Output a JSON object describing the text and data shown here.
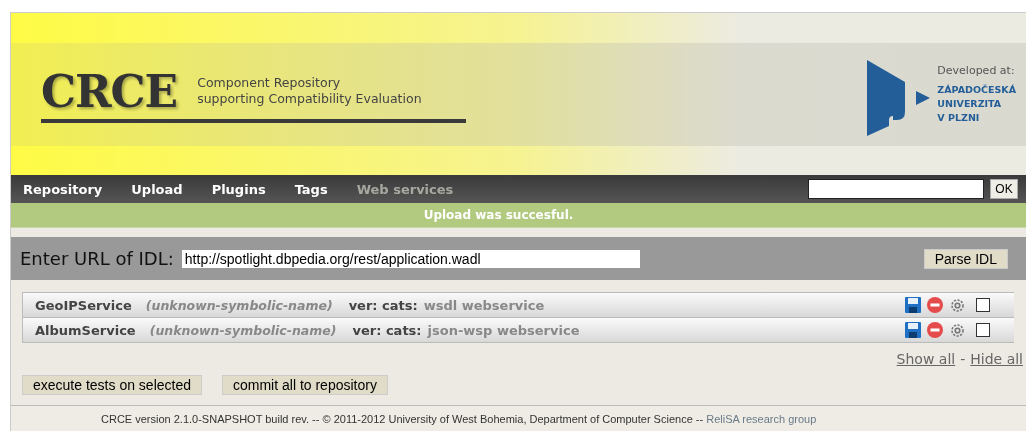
{
  "header": {
    "logo": "CRCE",
    "subtitle_lines": [
      "Component Repository",
      "supporting Compatibility Evaluation"
    ],
    "developed_at": "Developed at:",
    "university_lines": [
      "ZÁPADOČESKÁ",
      "UNIVERZITA",
      "V PLZNI"
    ]
  },
  "nav": {
    "items": [
      {
        "label": "Repository",
        "selected": false
      },
      {
        "label": "Upload",
        "selected": false
      },
      {
        "label": "Plugins",
        "selected": false
      },
      {
        "label": "Tags",
        "selected": false
      },
      {
        "label": "Web services",
        "selected": true
      }
    ],
    "search_button": "OK"
  },
  "message": "Upload was succesful.",
  "idl": {
    "label": "Enter URL of IDL:",
    "value": "http://spotlight.dbpedia.org/rest/application.wadl",
    "button": "Parse IDL"
  },
  "services": [
    {
      "name": "GeoIPService",
      "symbolic_name": "(unknown-symbolic-name)",
      "ver_label": "ver: cats:",
      "categories": "wsdl webservice",
      "checked": false
    },
    {
      "name": "AlbumService",
      "symbolic_name": "(unknown-symbolic-name)",
      "ver_label": "ver: cats:",
      "categories": "json-wsp webservice",
      "checked": false
    }
  ],
  "links": {
    "show": "Show all",
    "separator": "-",
    "hide": "Hide all"
  },
  "actions": [
    "execute tests on selected",
    "commit all to repository"
  ],
  "footer": {
    "text": "CRCE version 2.1.0-SNAPSHOT build rev. -- © 2011-2012 University of West Bohemia, Department of Computer Science --",
    "link": "ReliSA research group"
  }
}
